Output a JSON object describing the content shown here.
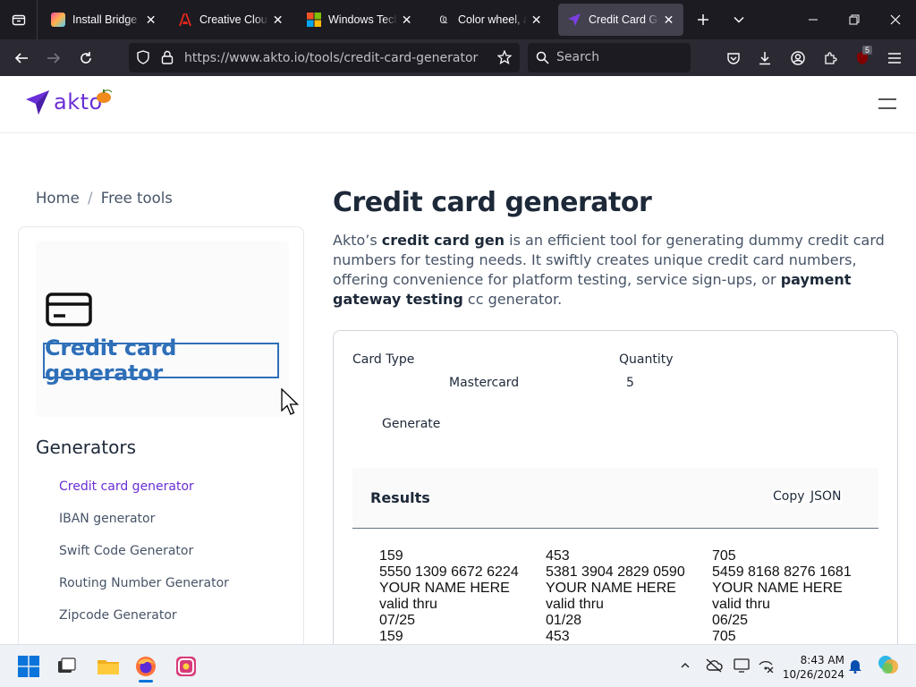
{
  "browser": {
    "tabs": [
      {
        "title": "Install Bridge | A",
        "active": false
      },
      {
        "title": "Creative Cloud: I",
        "active": false
      },
      {
        "title": "Windows Techni",
        "active": false
      },
      {
        "title": "Color wheel, a co",
        "active": false
      },
      {
        "title": "Credit Card Gen",
        "active": true
      }
    ],
    "url": "https://www.akto.io/tools/credit-card-generator",
    "search_placeholder": "Search",
    "extension_badge": "5"
  },
  "site": {
    "logo_text": "akto",
    "breadcrumb": {
      "home": "Home",
      "separator": "/",
      "current": "Free tools"
    }
  },
  "sidebar": {
    "card_title": "Credit card generator",
    "heading": "Generators",
    "items": [
      {
        "label": "Credit card generator",
        "active": true
      },
      {
        "label": "IBAN generator",
        "active": false
      },
      {
        "label": "Swift Code Generator",
        "active": false
      },
      {
        "label": "Routing Number Generator",
        "active": false
      },
      {
        "label": "Zipcode Generator",
        "active": false
      }
    ]
  },
  "main": {
    "title": "Credit card generator",
    "desc": {
      "p1": "Akto’s ",
      "b1": "credit card gen",
      "p2": " is an efficient tool for generating dummy credit card numbers for testing needs. It swiftly creates unique credit card numbers, offering convenience for platform testing, service sign-ups, or ",
      "b2": "payment gateway testing",
      "p3": " cc generator."
    },
    "form": {
      "card_type_label": "Card Type",
      "card_type_value": "Mastercard",
      "quantity_label": "Quantity",
      "quantity_value": "5",
      "generate_label": "Generate"
    },
    "results": {
      "title": "Results",
      "copy_label": "Copy",
      "json_label": "JSON",
      "cards": [
        {
          "cvv": "159",
          "number": "5550 1309 6672 6224",
          "name": "YOUR NAME HERE",
          "valid_label": "valid thru",
          "expiry": "07/25",
          "next": "159"
        },
        {
          "cvv": "453",
          "number": "5381 3904 2829 0590",
          "name": "YOUR NAME HERE",
          "valid_label": "valid thru",
          "expiry": "01/28",
          "next": "453"
        },
        {
          "cvv": "705",
          "number": "5459 8168 8276 1681",
          "name": "YOUR NAME HERE",
          "valid_label": "valid thru",
          "expiry": "06/25",
          "next": "705"
        }
      ]
    }
  },
  "taskbar": {
    "time": "8:43 AM",
    "date": "10/26/2024"
  },
  "colors": {
    "brand_purple": "#6a2fd6",
    "card_title_blue": "#2e6fb8",
    "browser_dark": "#1c1b22"
  }
}
